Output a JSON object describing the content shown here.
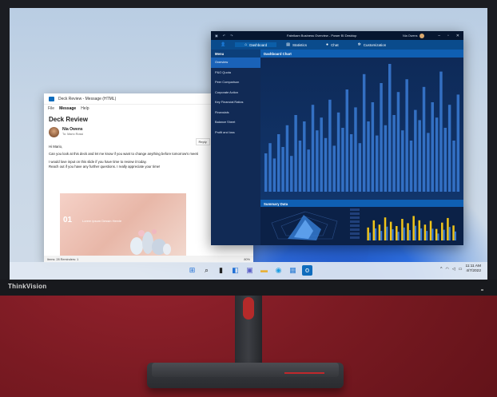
{
  "monitor": {
    "brand": "ThinkVision"
  },
  "outlook": {
    "title": "Deck Review - Message (HTML)",
    "menu": [
      "File",
      "Message",
      "Help"
    ],
    "subject": "Deck Review",
    "sender": "Nia Owens",
    "to": "To: Mario Rossi",
    "actions": [
      "Reply",
      "Reply All",
      "Forward"
    ],
    "date": "Thu 4/7/2022 8:1",
    "greeting": "Hi Mario,",
    "body1": "Can you look at this deck and let me know if you want to change anything before tomorrow's meeti",
    "body2": "I would love input on this slide if you have time to review it today.",
    "body3": "Reach out if you have any further questions. I really appreciate your time!",
    "slide_num": "01",
    "slide_caption": "Lorem ipsum Dessin Hervle",
    "status_items": "Items: 28   Reminders: 1",
    "zoom": "80%"
  },
  "powerbi": {
    "title": "Fabrikam Business Overview - Power BI Desktop",
    "user": "Nia Owens",
    "nav": [
      "Dashboard",
      "Statistics",
      "Chat",
      "Customization"
    ],
    "menu_title": "Menu",
    "menu": [
      "Overview",
      "P&O Quota",
      "Peer Comparison",
      "Corporate Action",
      "Key Financial Ratios",
      "Financials",
      "Balance Sheet",
      "Profit and loss"
    ],
    "chart_title": "Dashboard Chart",
    "summary_title": "Summary Data"
  },
  "chart_data": {
    "type": "bar",
    "title": "Dashboard Chart",
    "values": [
      30,
      38,
      26,
      45,
      35,
      52,
      28,
      60,
      40,
      55,
      33,
      68,
      48,
      58,
      42,
      72,
      36,
      62,
      50,
      80,
      45,
      66,
      38,
      92,
      55,
      70,
      44,
      85,
      52,
      100,
      60,
      78,
      48,
      88,
      40,
      64,
      56,
      82,
      46,
      70,
      58,
      94,
      50,
      68,
      40,
      76
    ],
    "ylim": [
      0,
      100
    ],
    "grid": false,
    "bar_color": "#3a7bd5"
  },
  "summary_chart": {
    "values": [
      45,
      70,
      55,
      80,
      65,
      50,
      75,
      60,
      85,
      70,
      55,
      68,
      40,
      62,
      78,
      52
    ],
    "colors": [
      "#f0c419",
      "#3a7bd5"
    ]
  },
  "taskbar": {
    "time": "11:11 AM",
    "date": "4/7/2022",
    "tray": "^"
  }
}
